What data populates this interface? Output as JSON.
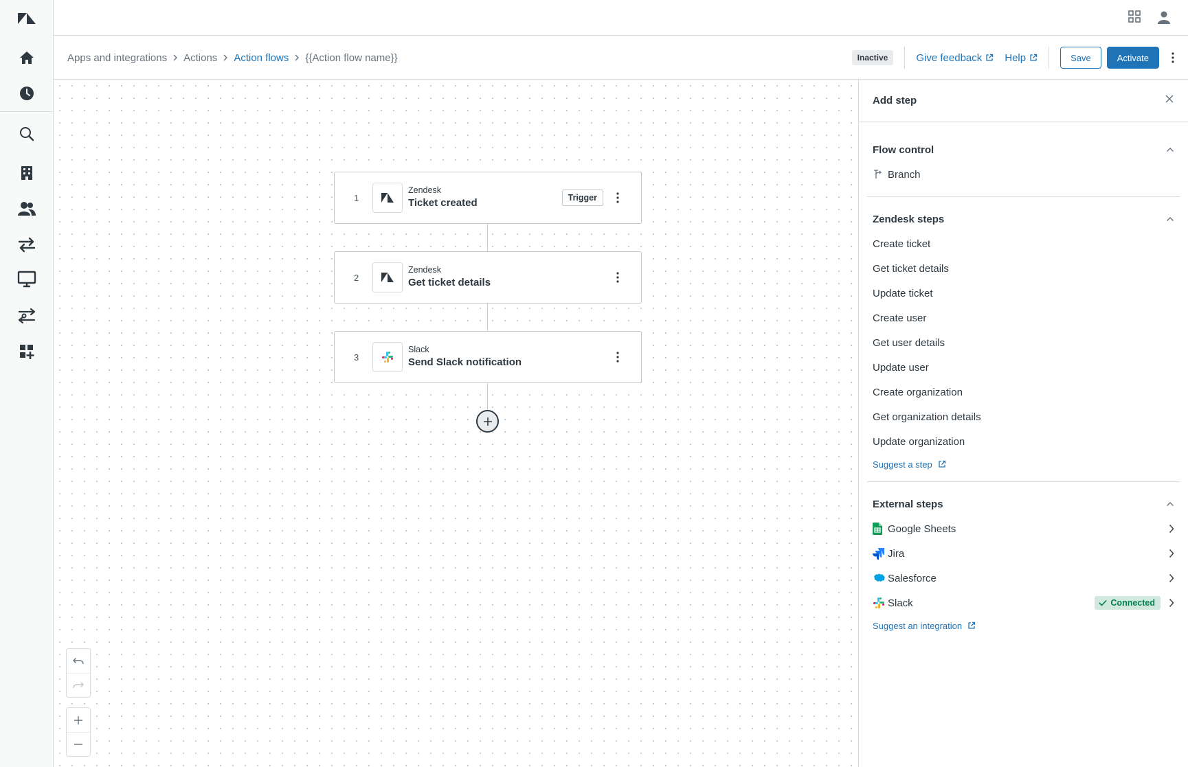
{
  "nav": {
    "icons": [
      "zendesk-logo",
      "home",
      "recent-clock",
      "search",
      "organizations",
      "users",
      "transfers",
      "display",
      "routing",
      "add-apps"
    ]
  },
  "breadcrumb": {
    "items": [
      "Apps and integrations",
      "Actions",
      "Action flows",
      "{{Action flow name}}"
    ]
  },
  "header": {
    "status": "Inactive",
    "feedback_label": "Give feedback",
    "help_label": "Help",
    "save_label": "Save",
    "activate_label": "Activate"
  },
  "flow": {
    "steps": [
      {
        "number": "1",
        "app": "Zendesk",
        "title": "Ticket created",
        "tag": "Trigger",
        "icon": "zendesk-icon"
      },
      {
        "number": "2",
        "app": "Zendesk",
        "title": "Get ticket details",
        "tag": "",
        "icon": "zendesk-icon"
      },
      {
        "number": "3",
        "app": "Slack",
        "title": "Send Slack notification",
        "tag": "",
        "icon": "slack-icon"
      }
    ]
  },
  "panel": {
    "title": "Add step",
    "flow_control": {
      "title": "Flow control",
      "items": [
        "Branch"
      ]
    },
    "zendesk_steps": {
      "title": "Zendesk steps",
      "items": [
        "Create ticket",
        "Get ticket details",
        "Update ticket",
        "Create user",
        "Get user details",
        "Update user",
        "Create organization",
        "Get organization details",
        "Update organization"
      ],
      "suggest_label": "Suggest a step"
    },
    "external_steps": {
      "title": "External steps",
      "items": [
        {
          "label": "Google Sheets",
          "icon": "google-sheets-icon",
          "badge": ""
        },
        {
          "label": "Jira",
          "icon": "jira-icon",
          "badge": ""
        },
        {
          "label": "Salesforce",
          "icon": "salesforce-icon",
          "badge": ""
        },
        {
          "label": "Slack",
          "icon": "slack-icon",
          "badge": "Connected"
        }
      ],
      "suggest_label": "Suggest an integration"
    }
  },
  "colors": {
    "accent": "#1f73b7",
    "text": "#2f3941",
    "connected_bg": "#d1e8df",
    "connected_text": "#037f52"
  }
}
